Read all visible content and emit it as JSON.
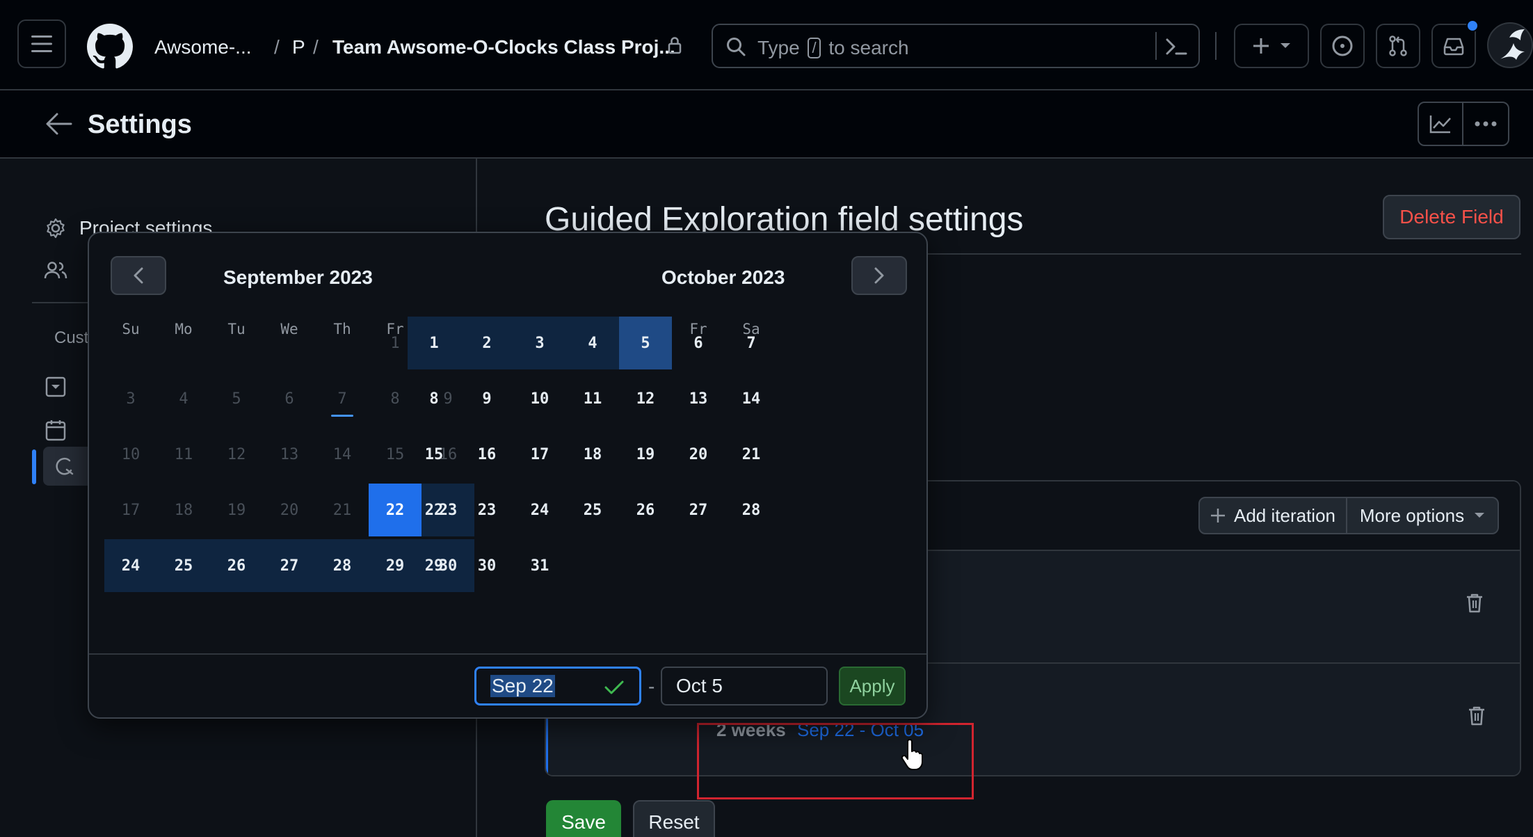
{
  "header": {
    "org": "Awsome-...",
    "sep1": "/",
    "project_initial": "P",
    "sep2": "/",
    "project_name": "Team Awsome-O-Clocks Class Proj...",
    "search_placeholder_pre": "Type",
    "search_key": "/",
    "search_placeholder_post": "to search"
  },
  "subheader": {
    "title": "Settings"
  },
  "sidebar": {
    "project_settings": "Project settings",
    "custom_fields_heading": "Cust"
  },
  "main": {
    "title": "Guided Exploration field settings",
    "delete_label": "Delete Field",
    "add_iteration_label": "Add iteration",
    "more_options_label": "More options",
    "iteration_duration": "2 weeks",
    "iteration_range": "Sep 22 - Oct 05",
    "save_label": "Save",
    "reset_label": "Reset"
  },
  "calendar": {
    "left_month": "September 2023",
    "right_month": "October 2023",
    "weekdays": [
      "Su",
      "Mo",
      "Tu",
      "We",
      "Th",
      "Fr",
      "Sa"
    ],
    "start_input": "Sep 22",
    "range_dash": "-",
    "end_input": "Oct 5",
    "apply_label": "Apply",
    "september": {
      "first_weekday_index": 5,
      "days_in_month": 30,
      "today": 7,
      "range_start": 22,
      "in_range_from": 23
    },
    "october": {
      "first_weekday_index": 0,
      "days_in_month": 31,
      "range_end": 5
    }
  },
  "colors": {
    "accent": "#1f6feb",
    "danger": "#f85149",
    "success": "#238636",
    "highlight_box": "#d1242f"
  }
}
